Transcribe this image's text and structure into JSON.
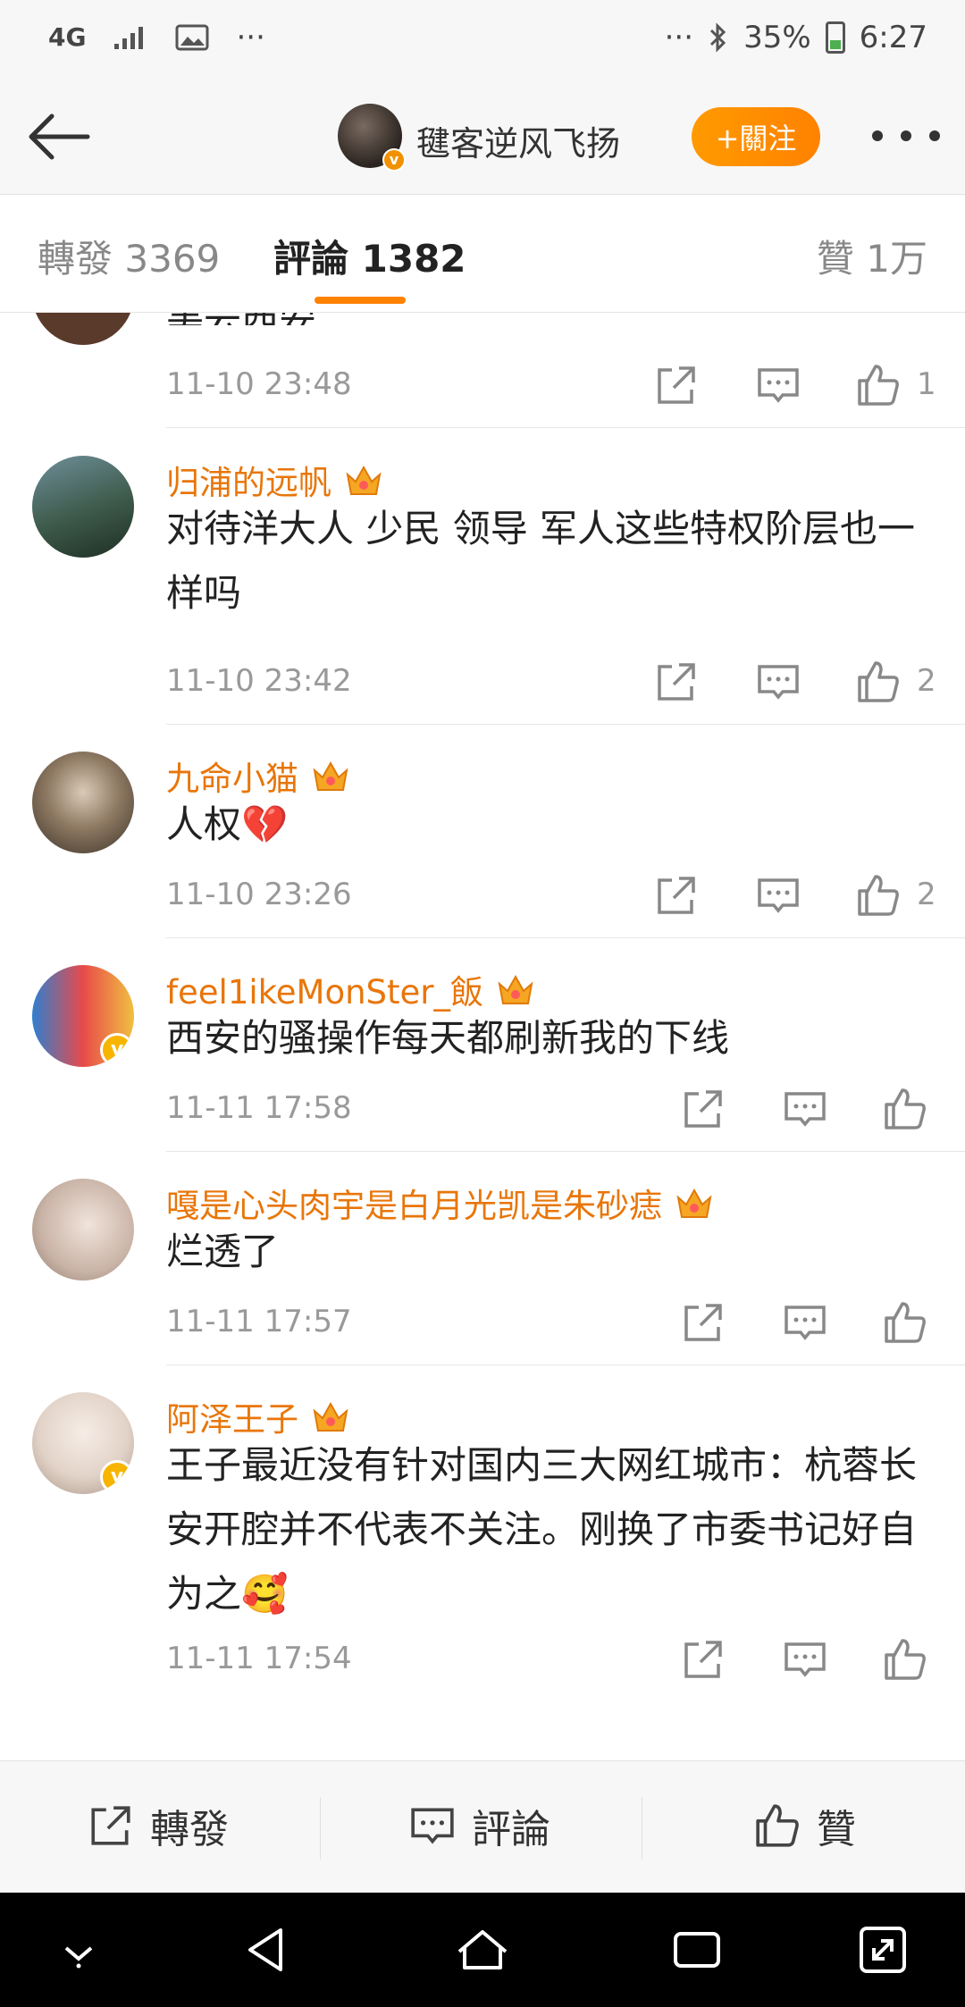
{
  "status_bar": {
    "network": "4G",
    "more_left": "···",
    "more_right": "···",
    "battery": "35%",
    "time": "6:27"
  },
  "header": {
    "user_name": "毽客逆风飞扬",
    "follow_label": "+關注"
  },
  "tabs": [
    {
      "label": "轉發",
      "count": "3369",
      "active": false
    },
    {
      "label": "評論",
      "count": "1382",
      "active": true
    },
    {
      "label": "贊",
      "count": "1万",
      "active": false
    }
  ],
  "comments": [
    {
      "partial_text": "美云西安",
      "time": "11-10 23:48",
      "likes": "1"
    },
    {
      "user": "归浦的远帆",
      "text": "对待洋大人 少民 领导 军人这些特权阶层也一样吗",
      "time": "11-10 23:42",
      "likes": "2",
      "verified": false
    },
    {
      "user": "九命小猫",
      "text": "人权💔",
      "time": "11-10 23:26",
      "likes": "2",
      "verified": false
    },
    {
      "user": "feel1ikeMonSter_飯",
      "text": "西安的骚操作每天都刷新我的下线",
      "time": "11-11 17:58",
      "likes": "",
      "verified": true
    },
    {
      "user": "嘎是心头肉宇是白月光凯是朱砂痣",
      "text": "烂透了",
      "time": "11-11 17:57",
      "likes": "",
      "verified": false
    },
    {
      "user": "阿泽王子",
      "text": "王子最近没有针对国内三大网红城市：杭蓉长安开腔并不代表不关注。刚换了市委书记好自为之🥰",
      "time": "11-11 17:54",
      "likes": "",
      "verified": true
    }
  ],
  "bottom_bar": {
    "repost_label": "轉發",
    "comment_label": "評論",
    "like_label": "贊"
  },
  "colors": {
    "accent": "#ff8200",
    "username": "#e8760a",
    "muted": "#999999"
  }
}
